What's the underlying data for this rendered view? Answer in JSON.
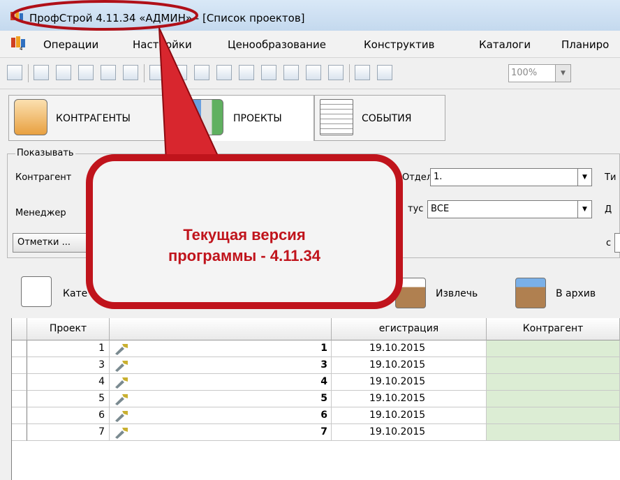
{
  "window": {
    "title": "ПрофСтрой 4.11.34 «АДМИН» - [Список проектов]"
  },
  "menu": {
    "items": [
      "Операции",
      "Настройки",
      "Ценообразование",
      "Конструктив",
      "Каталоги",
      "Планиро"
    ]
  },
  "toolbar": {
    "zoom_value": "100%",
    "buttons": [
      "list-icon",
      "properties-icon",
      "import-icon",
      "export-icon",
      "print-preview-icon",
      "clipboard-icon",
      "filter-icon",
      "table-icon",
      "tree-icon",
      "move-icon",
      "edit-icon",
      "chart-icon",
      "chart2-icon",
      "tools-icon",
      "delete-icon",
      "split-icon",
      "grid-icon"
    ]
  },
  "tabs": [
    {
      "label": "КОНТРАГЕНТЫ",
      "icon": "person-icon"
    },
    {
      "label": "ПРОЕКТЫ",
      "icon": "binders-icon"
    },
    {
      "label": "СОБЫТИЯ",
      "icon": "document-icon"
    }
  ],
  "filter": {
    "legend": "Показывать",
    "contractor_label": "Контрагент",
    "department_label": "Отдел",
    "department_value": "1.",
    "type_label": "Ти",
    "manager_label": "Менеджер",
    "status_label": "тус",
    "status_value": "ВСЕ",
    "date_label": "Д",
    "marks_button": "Отметки ...",
    "from_label": "с"
  },
  "actions": {
    "category": "Кате",
    "extract": "Извлечь",
    "archive": "В архив"
  },
  "grid": {
    "columns": {
      "project": "Проект",
      "registration": "егистрация",
      "contractor": "Контрагент"
    },
    "rows": [
      {
        "project": "1",
        "number": "1",
        "date": "19.10.2015"
      },
      {
        "project": "3",
        "number": "3",
        "date": "19.10.2015"
      },
      {
        "project": "4",
        "number": "4",
        "date": "19.10.2015"
      },
      {
        "project": "5",
        "number": "5",
        "date": "19.10.2015"
      },
      {
        "project": "6",
        "number": "6",
        "date": "19.10.2015"
      },
      {
        "project": "7",
        "number": "7",
        "date": "19.10.2015"
      }
    ]
  },
  "callout": {
    "line1": "Текущая версия",
    "line2": "программы - 4.11.34"
  },
  "colors": {
    "callout_text": "#c0141c",
    "callout_border": "#b01018",
    "contractor_cell": "#dcedd4"
  }
}
